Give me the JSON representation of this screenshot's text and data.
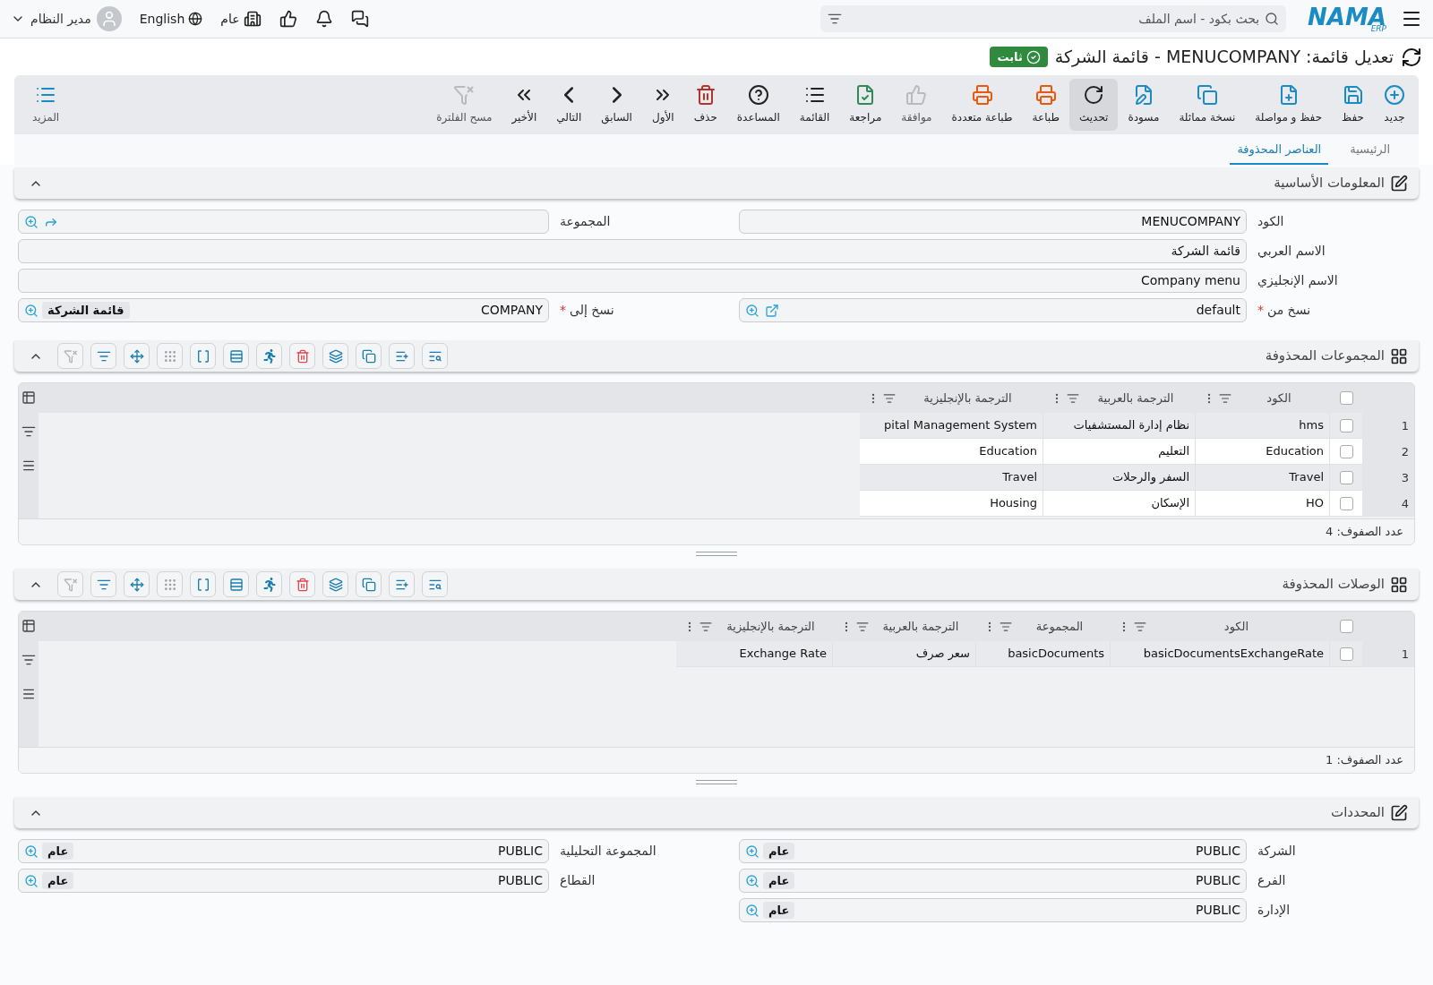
{
  "top_bar": {
    "logo": "NAMA",
    "logo_sub": "ERP",
    "search": {
      "placeholder": "بحث بكود - اسم الملف"
    },
    "company": "عام",
    "language": "English",
    "user": "مدير النظام"
  },
  "title": "تعديل قائمة: MENUCOMPANY - قائمة الشركة",
  "status_badge": "ثابت",
  "toolbar": [
    {
      "label": "جديد",
      "disabled": false,
      "selected": false
    },
    {
      "label": "حفظ",
      "disabled": false,
      "selected": false
    },
    {
      "label": "حفظ و مواصلة",
      "disabled": false,
      "selected": false
    },
    {
      "label": "نسخة مماثلة",
      "disabled": false,
      "selected": false
    },
    {
      "label": "مسودة",
      "disabled": false,
      "selected": false
    },
    {
      "label": "تحديث",
      "disabled": false,
      "selected": true
    },
    {
      "label": "طباعة",
      "disabled": false,
      "selected": false
    },
    {
      "label": "طباعة متعددة",
      "disabled": false,
      "selected": false
    },
    {
      "label": "موافقة",
      "disabled": true,
      "selected": false
    },
    {
      "label": "مراجعة",
      "disabled": false,
      "selected": false
    },
    {
      "label": "القائمة",
      "disabled": false,
      "selected": false
    },
    {
      "label": "المساعدة",
      "disabled": false,
      "selected": false
    },
    {
      "label": "حذف",
      "disabled": false,
      "selected": false
    },
    {
      "label": "الأول",
      "disabled": false,
      "selected": false
    },
    {
      "label": "السابق",
      "disabled": false,
      "selected": false
    },
    {
      "label": "التالي",
      "disabled": false,
      "selected": false
    },
    {
      "label": "الأخير",
      "disabled": false,
      "selected": false
    },
    {
      "label": "مسح الفلترة",
      "disabled": true,
      "selected": false
    }
  ],
  "more": "المزيد",
  "tabs": [
    {
      "label": "الرئيسية",
      "selected": false
    },
    {
      "label": "العناصر المحذوفة",
      "selected": true
    }
  ],
  "sections": [
    {
      "kind": "form",
      "title": "المعلومات الأساسية",
      "expanded": true,
      "rows": [
        [
          {
            "label": "الكود",
            "value": "MENUCOMPANY",
            "kind": "text"
          },
          {
            "label": "المجموعة",
            "kind": "lookup-forward"
          }
        ],
        [
          {
            "label": "الاسم العربي",
            "value": "قائمة الشركة",
            "kind": "text"
          }
        ],
        [
          {
            "label": "الاسم الإنجليزي",
            "value": "Company menu",
            "kind": "text"
          }
        ],
        [
          {
            "label": "نسخ من",
            "value": "default",
            "kind": "lookup-open",
            "required_mark": "*"
          },
          {
            "label": "نسخ إلى",
            "value": "COMPANY",
            "kind": "lookup",
            "required_mark": "*",
            "tag": "قائمة الشركة"
          }
        ]
      ]
    },
    {
      "kind": "grid",
      "title": "المجموعات المحذوفة",
      "expanded": true,
      "all_checked": false,
      "columns": [
        "الكود",
        "الترجمة بالعربية",
        "الترجمة بالإنجليزية"
      ],
      "rows": [
        {
          "number": "1",
          "checked": false,
          "cells": [
            "hms",
            "نظام إدارة المستشفيات",
            "pital Management System"
          ]
        },
        {
          "number": "2",
          "checked": false,
          "cells": [
            "Education",
            "التعليم",
            "Education"
          ]
        },
        {
          "number": "3",
          "checked": false,
          "cells": [
            "Travel",
            "السفر والرحلات",
            "Travel"
          ]
        },
        {
          "number": "4",
          "checked": false,
          "cells": [
            "HO",
            "الإسكان",
            "Housing"
          ]
        }
      ],
      "row_count": "عدد الصفوف: 4"
    },
    {
      "kind": "grid",
      "title": "الوصلات المحذوفة",
      "expanded": true,
      "all_checked": false,
      "columns": [
        "الكود",
        "المجموعة",
        "الترجمة بالعربية",
        "الترجمة بالإنجليزية"
      ],
      "rows": [
        {
          "number": "1",
          "checked": false,
          "cells": [
            "basicDocumentsExchangeRate",
            "basicDocuments",
            "سعر صرف",
            "Exchange Rate"
          ]
        }
      ],
      "row_count": "عدد الصفوف: 1"
    },
    {
      "kind": "form",
      "title": "المحددات",
      "expanded": true,
      "rows": [
        [
          {
            "label": "الشركة",
            "value": "PUBLIC",
            "kind": "lookup",
            "tag": "عام"
          },
          {
            "label": "المجموعة التحليلية",
            "value": "PUBLIC",
            "kind": "lookup",
            "tag": "عام"
          }
        ],
        [
          {
            "label": "الفرع",
            "value": "PUBLIC",
            "kind": "lookup",
            "tag": "عام"
          },
          {
            "label": "القطاع",
            "value": "PUBLIC",
            "kind": "lookup",
            "tag": "عام"
          }
        ],
        [
          {
            "label": "الإدارة",
            "value": "PUBLIC",
            "kind": "lookup",
            "tag": "عام"
          }
        ]
      ]
    }
  ]
}
